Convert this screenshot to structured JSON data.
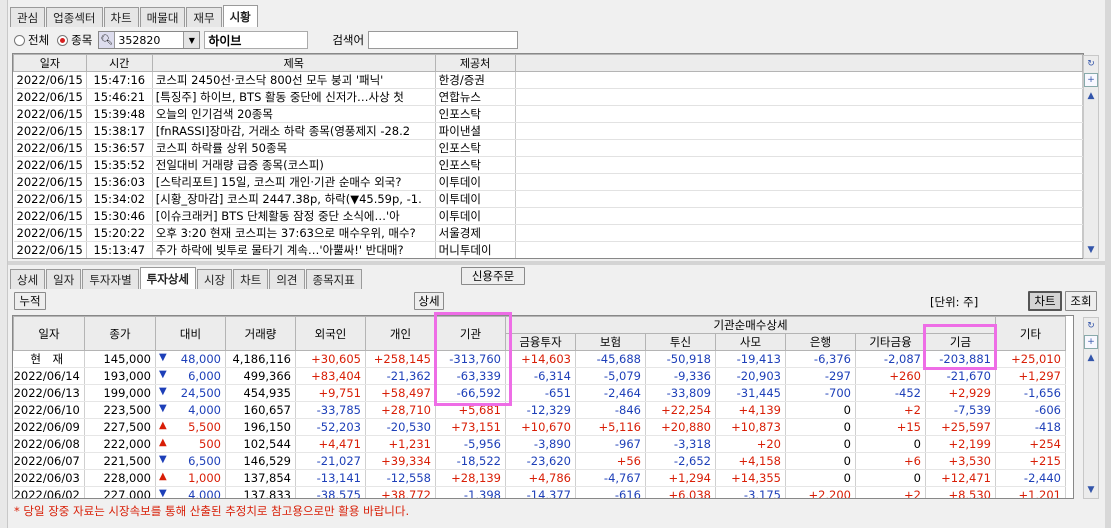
{
  "top_tabs": [
    "관심",
    "업종섹터",
    "차트",
    "매물대",
    "재무",
    "시황"
  ],
  "top_tab_active": 5,
  "filter": {
    "all_label": "전체",
    "stock_label": "종목",
    "selected": "stock"
  },
  "stock": {
    "code": "352820",
    "name": "하이브"
  },
  "search": {
    "label": "검색어",
    "value": ""
  },
  "news": {
    "columns": [
      "일자",
      "시간",
      "제목",
      "제공처"
    ],
    "rows": [
      [
        "2022/06/15",
        "15:47:16",
        "코스피 2450선·코스닥 800선 모두 붕괴 '패닉'",
        "한경/증권"
      ],
      [
        "2022/06/15",
        "15:46:21",
        "[특징주] 하이브, BTS 활동 중단에 신저가…사상 첫",
        "연합뉴스"
      ],
      [
        "2022/06/15",
        "15:39:48",
        "오늘의 인기검색 20종목",
        "인포스탁"
      ],
      [
        "2022/06/15",
        "15:38:17",
        "[fnRASSI]장마감, 거래소 하락 종목(영풍제지 -28.2",
        "파이낸셜"
      ],
      [
        "2022/06/15",
        "15:36:57",
        "코스피 하락률 상위 50종목",
        "인포스탁"
      ],
      [
        "2022/06/15",
        "15:35:52",
        "전일대비 거래량 급증 종목(코스피)",
        "인포스탁"
      ],
      [
        "2022/06/15",
        "15:36:03",
        "[스탁리포트] 15일, 코스피 개인·기관 순매수 외국?",
        "이투데이"
      ],
      [
        "2022/06/15",
        "15:34:02",
        "[시황_장마감] 코스피 2447.38p, 하락(▼45.59p, -1.",
        "이투데이"
      ],
      [
        "2022/06/15",
        "15:30:46",
        "[이슈크래커] BTS 단체활동 잠정 중단 소식에…'아",
        "이투데이"
      ],
      [
        "2022/06/15",
        "15:20:22",
        "오후 3:20 현재 코스피는 37:63으로 매수우위, 매수?",
        "서울경제"
      ],
      [
        "2022/06/15",
        "15:13:47",
        "주가 하락에 빚투로 물타기 계속…'아뿔싸!' 반대매?",
        "머니투데이"
      ]
    ]
  },
  "sub_tabs": [
    "상세",
    "일자",
    "투자자별",
    "투자상세",
    "시장",
    "차트",
    "의견",
    "종목지표"
  ],
  "sub_tab_active": 3,
  "credit_order_label": "신용주문",
  "buttons": {
    "cumulative": "누적",
    "detail": "상세",
    "unit": "[단위: 주]",
    "chart": "차트",
    "query": "조회"
  },
  "investor": {
    "group_header": "기관순매수상세",
    "columns": [
      "일자",
      "종가",
      "대비",
      "거래량",
      "외국인",
      "개인",
      "기관",
      "금융투자",
      "보험",
      "투신",
      "사모",
      "은행",
      "기타금융",
      "기금",
      "기타"
    ],
    "rows": [
      {
        "date": "현　재",
        "close": "145,000",
        "dir": "down",
        "chg": "48,000",
        "vol": "4,186,116",
        "v": [
          "+30,605",
          "+258,145",
          "-313,760",
          "+14,603",
          "-45,688",
          "-50,918",
          "-19,413",
          "-6,376",
          "-2,087",
          "-203,881",
          "+25,010"
        ]
      },
      {
        "date": "2022/06/14",
        "close": "193,000",
        "dir": "down",
        "chg": "6,000",
        "vol": "499,366",
        "v": [
          "+83,404",
          "-21,362",
          "-63,339",
          "-6,314",
          "-5,079",
          "-9,336",
          "-20,903",
          "-297",
          "+260",
          "-21,670",
          "+1,297"
        ]
      },
      {
        "date": "2022/06/13",
        "close": "199,000",
        "dir": "down",
        "chg": "24,500",
        "vol": "454,935",
        "v": [
          "+9,751",
          "+58,497",
          "-66,592",
          "-651",
          "-2,464",
          "-33,809",
          "-31,445",
          "-700",
          "-452",
          "+2,929",
          "-1,656"
        ]
      },
      {
        "date": "2022/06/10",
        "close": "223,500",
        "dir": "down",
        "chg": "4,000",
        "vol": "160,657",
        "v": [
          "-33,785",
          "+28,710",
          "+5,681",
          "-12,329",
          "-846",
          "+22,254",
          "+4,139",
          "0",
          "+2",
          "-7,539",
          "-606"
        ]
      },
      {
        "date": "2022/06/09",
        "close": "227,500",
        "dir": "up",
        "chg": "5,500",
        "vol": "196,150",
        "v": [
          "-52,203",
          "-20,530",
          "+73,151",
          "+10,670",
          "+5,116",
          "+20,880",
          "+10,873",
          "0",
          "+15",
          "+25,597",
          "-418"
        ]
      },
      {
        "date": "2022/06/08",
        "close": "222,000",
        "dir": "up",
        "chg": "500",
        "vol": "102,544",
        "v": [
          "+4,471",
          "+1,231",
          "-5,956",
          "-3,890",
          "-967",
          "-3,318",
          "+20",
          "0",
          "0",
          "+2,199",
          "+254"
        ]
      },
      {
        "date": "2022/06/07",
        "close": "221,500",
        "dir": "down",
        "chg": "6,500",
        "vol": "146,529",
        "v": [
          "-21,027",
          "+39,334",
          "-18,522",
          "-23,620",
          "+56",
          "-2,652",
          "+4,158",
          "0",
          "+6",
          "+3,530",
          "+215"
        ]
      },
      {
        "date": "2022/06/03",
        "close": "228,000",
        "dir": "up",
        "chg": "1,000",
        "vol": "137,854",
        "v": [
          "-13,141",
          "-12,558",
          "+28,139",
          "+4,786",
          "-4,767",
          "+1,294",
          "+14,355",
          "0",
          "0",
          "+12,471",
          "-2,440"
        ]
      },
      {
        "date": "2022/06/02",
        "close": "227,000",
        "dir": "down",
        "chg": "4,000",
        "vol": "137,833",
        "v": [
          "-38,575",
          "+38,772",
          "-1,398",
          "-14,377",
          "-616",
          "+6,038",
          "-3,175",
          "+2,200",
          "+2",
          "+8,530",
          "+1,201"
        ]
      }
    ]
  },
  "footnote": "* 당일 장중 자료는 시장속보를 통해 산출된 추정치로 참고용으로만 활용 바랍니다.",
  "colors": {
    "up": "#d81e06",
    "down": "#1d3fb8",
    "highlight": "#ee6de6"
  }
}
